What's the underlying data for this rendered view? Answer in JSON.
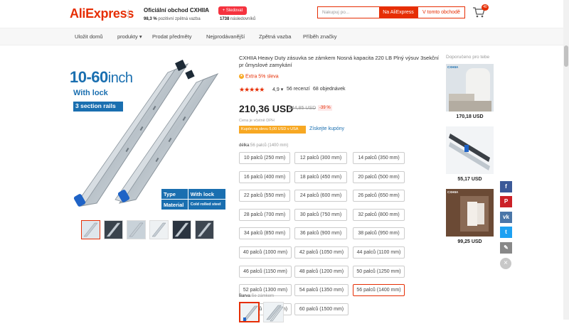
{
  "header": {
    "logo": "AliExpress",
    "store_name": "Oficiální obchod CXHIIA",
    "store_chevron": "▾",
    "store_rating_value": "98,3 %",
    "store_rating_text": "pozitivní zpětná vazba",
    "follow_label": "+ Sledovat",
    "followers_count": "1738",
    "followers_text": "následovníků",
    "search_placeholder": "Nakupuj po...",
    "search_ali_label": "Na AliExpress",
    "search_store_label": "V tomto obchodě",
    "cart_count": "40"
  },
  "nav": {
    "items": [
      "Uložit domů",
      "produkty",
      "Prodat předměty",
      "Nejprodávanější",
      "Zpětná vazba",
      "Příběh značky"
    ],
    "products_chevron": "▾"
  },
  "gallery": {
    "title_main": "10-60",
    "title_unit": "inch",
    "with_lock": "With lock",
    "section_rails": "3 section rails",
    "spec_type_label": "Type",
    "spec_type_value": "With lock",
    "spec_material_label": "Material",
    "spec_material_value": "Cold rolled steel",
    "thumbnail_count": 6,
    "active_thumbnail": 1
  },
  "product": {
    "title": "CXHIIA Heavy Duty zásuvka se zámkem Nosná kapacita 220 LB Plný výsuv 3sekční pr ůmyslové zamykání",
    "extra_icon": "★",
    "extra_discount": "Extra 5% sleva",
    "stars": "★★★★★",
    "rating": "4,9",
    "rating_chevron": "▾",
    "reviews": "56 recenzí",
    "orders": "68 objednávek",
    "price": "210,36 USD",
    "old_price": "344,85 USD",
    "discount": "-39 %",
    "vat_note": "Cena je včetně DPH",
    "coupon": "Kupón na slevu 5,00 USD v USA",
    "get_coupons": "Získejte kupóny",
    "length_label": "délka",
    "length_selected": ":56 palců (1400 mm)",
    "lengths": [
      "10 palců (250 mm)",
      "12 palců (300 mm)",
      "14 palců (350 mm)",
      "16 palců (400 mm)",
      "18 palců (450 mm)",
      "20 palců (500 mm)",
      "22 palců (550 mm)",
      "24 palců (600 mm)",
      "26 palců (650 mm)",
      "28 palců (700 mm)",
      "30 palců (750 mm)",
      "32 palců (800 mm)",
      "34 palců (850 mm)",
      "36 palců (900 mm)",
      "38 palců (950 mm)",
      "40 palců (1000 mm)",
      "42 palců (1050 mm)",
      "44 palců (1100 mm)",
      "46 palců (1150 mm)",
      "48 palců (1200 mm)",
      "50 palců (1250 mm)",
      "52 palců (1300 mm)",
      "54 palců (1350 mm)",
      "56 palců (1400 mm)",
      "58 palců (1450 mm)",
      "60 palců (1500 mm)"
    ],
    "selected_length_index": 23,
    "color_label": "Barva",
    "color_selected": ":Se zámkem"
  },
  "recommendations": {
    "title": "Doporučeno pro tebe",
    "items": [
      {
        "brand": "CXHIIA",
        "price": "170,18 USD"
      },
      {
        "brand": "",
        "price": "55,17 USD"
      },
      {
        "brand": "CXHIIA",
        "price": "99,25 USD"
      }
    ]
  },
  "share": {
    "icons": [
      "facebook-icon",
      "pinterest-icon",
      "vk-icon",
      "twitter-icon",
      "edit-icon"
    ],
    "glyphs": [
      "f",
      "P",
      "vk",
      "t",
      "✎"
    ],
    "colors": [
      "#3b5998",
      "#cb2027",
      "#4a76a8",
      "#1da1f2",
      "#888888"
    ],
    "close_glyph": "×"
  },
  "colors": {
    "accent": "#e62e04",
    "brand_blue": "#1a6fb0",
    "coupon": "#f7a823"
  }
}
